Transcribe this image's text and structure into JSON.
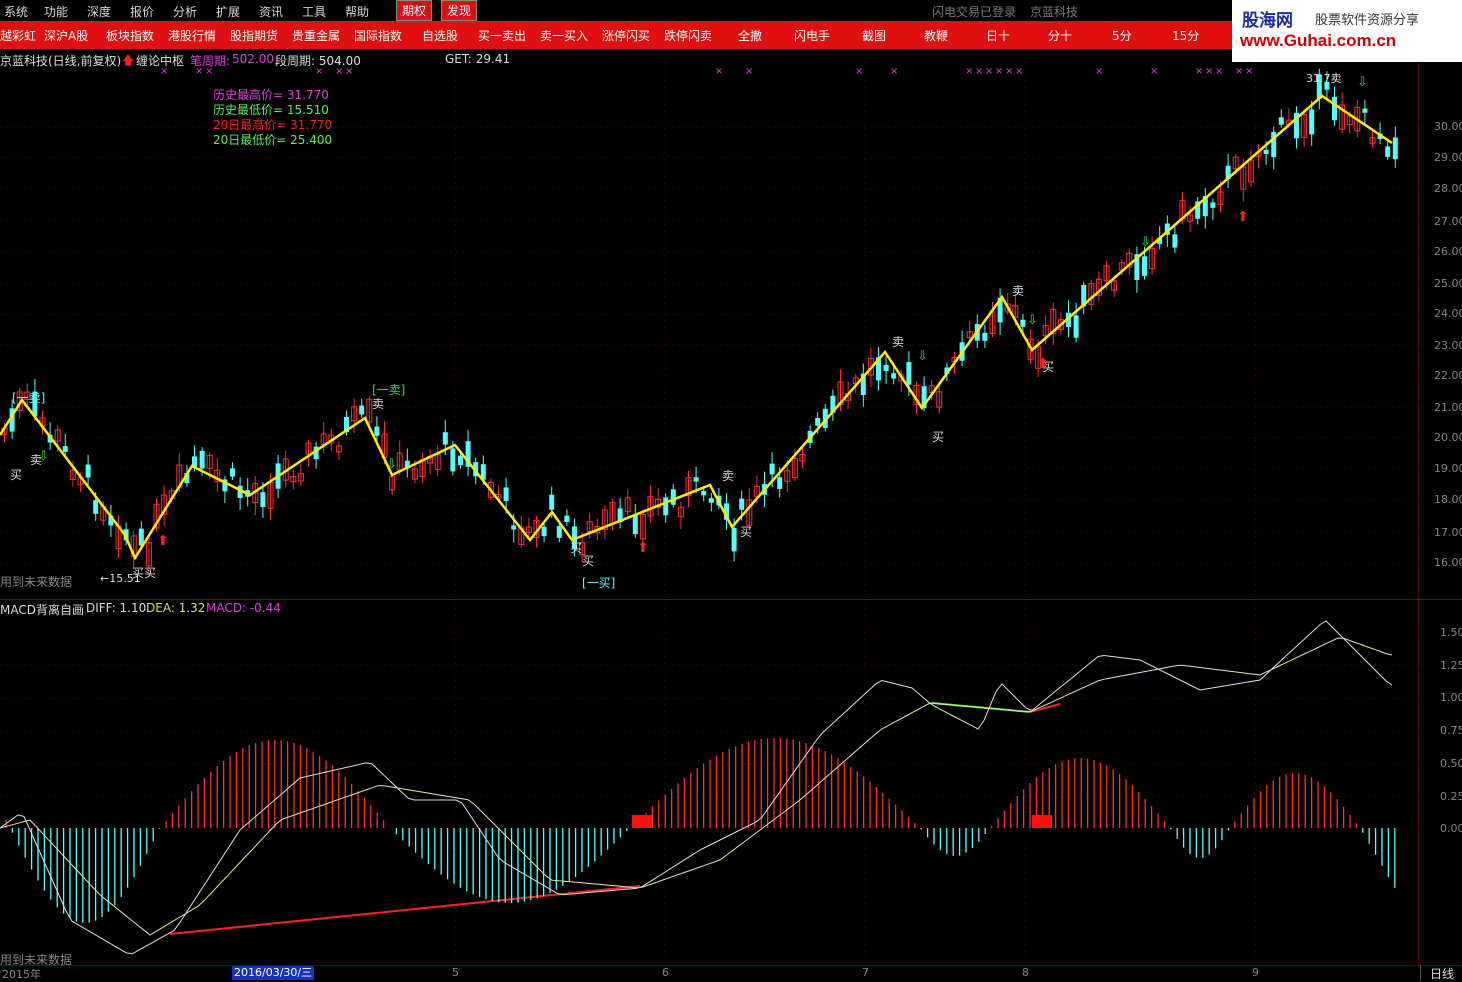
{
  "menu": {
    "items": [
      "系统",
      "功能",
      "深度",
      "报价",
      "分析",
      "扩展",
      "资讯",
      "工具",
      "帮助"
    ],
    "tabs": [
      "期权",
      "发现"
    ],
    "status": "闪电交易已登录",
    "stock": "京蓝科技"
  },
  "toolbar": [
    "越彩虹",
    "深沪A股",
    "板块指数",
    "港股行情",
    "股指期货",
    "贵重金属",
    "国际指数",
    "自选股",
    "买一卖出",
    "卖一买入",
    "涨停闪买",
    "跌停闪卖",
    "全撤",
    "闪电手",
    "截图",
    "教鞭",
    "日十",
    "分十",
    "5分",
    "15分"
  ],
  "logo": {
    "cn": "股海网",
    "slogan": "股票软件资源分享",
    "url": "www.Guhai.com.cn"
  },
  "main_chart": {
    "title": "京蓝科技(日线,前复权)",
    "indicator": "缠论中枢",
    "bi_period_label": "笔周期:",
    "bi_period_value": "502.00",
    "duan_period": "段周期: 504.00",
    "get": "GET: 29.41",
    "stats": {
      "hist_high": "历史最高价= 31.770",
      "hist_low": "历史最低价= 15.510",
      "d20_high": "20日最高价= 31.770",
      "d20_low": "20日最低价= 25.400"
    },
    "future_note": "用到未来数据",
    "y_ticks": [
      "30.00",
      "29.00",
      "28.00",
      "27.00",
      "26.00",
      "25.00",
      "24.00",
      "23.00",
      "22.00",
      "21.00",
      "20.00",
      "19.00",
      "18.00",
      "17.00",
      "16.00"
    ],
    "marks": {
      "low_label": "←15.51",
      "high_label": "31.7卖",
      "yi_mai_top": "[一卖]",
      "yi_mai_mid": "[一卖]",
      "yi_mai_bottom": "[一买]",
      "buy": "买",
      "sell": "卖",
      "buy_buy": "买买"
    }
  },
  "macd": {
    "title": "MACD背离自画",
    "diff": "DIFF: 1.10",
    "dea": "DEA: 1.32",
    "macd": "MACD: -0.44",
    "future_note": "用到未来数据",
    "y_ticks": [
      "1.50",
      "1.25",
      "1.00",
      "0.75",
      "0.50",
      "0.25",
      "0.00"
    ]
  },
  "x_axis": {
    "labels": [
      "2015年",
      "5",
      "6",
      "7",
      "8",
      "9"
    ],
    "selected_date": "2016/03/30/三",
    "period": "日线"
  },
  "colors": {
    "up": "#ff3030",
    "down": "#54ffff",
    "zigzag": "#ffee00",
    "grid": "#5a0000",
    "accent_red": "#e01010"
  }
}
